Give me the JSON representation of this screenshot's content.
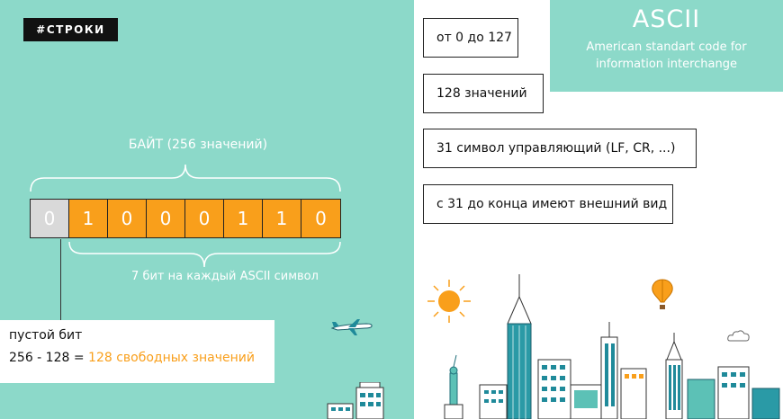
{
  "tag": "#СТРОКИ",
  "byte_label": "БАЙТ (256 значений)",
  "bits": [
    "0",
    "1",
    "0",
    "0",
    "0",
    "1",
    "1",
    "0"
  ],
  "bits_caption": "7 бит на каждый ASCII символ",
  "empty_bit": {
    "title": "пустой бит",
    "formula_prefix": "256 - 128 = ",
    "formula_highlight": "128 свободных значений"
  },
  "facts": [
    "от 0 до 127",
    "128 значений",
    "31 символ управляющий (LF, CR, ...)",
    "с 31 до конца имеют внешний вид"
  ],
  "ascii": {
    "title": "ASCII",
    "subtitle_line1": "American standart code for",
    "subtitle_line2": "information interchange"
  },
  "colors": {
    "teal": "#8cd9c9",
    "orange": "#f99f1b",
    "gray": "#d9d9d9",
    "dark": "#111111"
  }
}
